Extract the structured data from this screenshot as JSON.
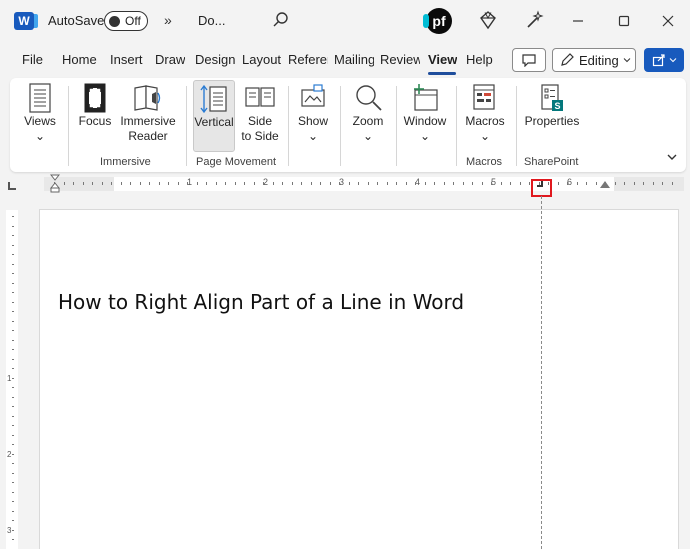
{
  "titlebar": {
    "autosave_label": "AutoSave",
    "autosave_state": "Off",
    "more_chevron": "»",
    "doc_title": "Do...",
    "logo_text": "pf"
  },
  "tabs": [
    {
      "label": "File"
    },
    {
      "label": "Home"
    },
    {
      "label": "Insert"
    },
    {
      "label": "Draw"
    },
    {
      "label": "Design"
    },
    {
      "label": "Layout"
    },
    {
      "label": "References"
    },
    {
      "label": "Mailings"
    },
    {
      "label": "Review"
    },
    {
      "label": "View",
      "active": true
    },
    {
      "label": "Help"
    }
  ],
  "right_buttons": {
    "editing_label": "Editing"
  },
  "ribbon": {
    "views": "Views",
    "focus": "Focus",
    "immersive_reader_1": "Immersive",
    "immersive_reader_2": "Reader",
    "vertical": "Vertical",
    "side_to_side_1": "Side",
    "side_to_side_2": "to Side",
    "show": "Show",
    "zoom": "Zoom",
    "window": "Window",
    "macros": "Macros",
    "properties": "Properties",
    "group_immersive": "Immersive",
    "group_page_movement": "Page Movement",
    "group_macros": "Macros",
    "group_sharepoint": "SharePoint"
  },
  "ruler": {
    "numbers": [
      "1",
      "2",
      "3",
      "4",
      "5",
      "6"
    ]
  },
  "vruler": {
    "numbers": [
      "1",
      "2",
      "3"
    ]
  },
  "document": {
    "text": "How to Right Align Part of a Line in Word"
  },
  "colors": {
    "accent": "#185abd",
    "highlight": "#e0181e"
  }
}
